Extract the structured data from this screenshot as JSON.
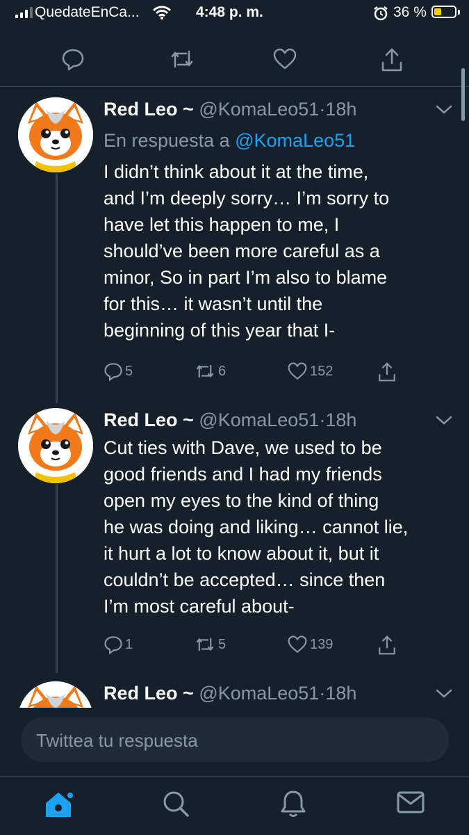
{
  "status_bar": {
    "carrier": "QuedateEnCa...",
    "time": "4:48 p. m.",
    "battery_percent": "36 %",
    "battery_level": 0.36,
    "icons": [
      "signal-icon",
      "wifi-icon",
      "alarm-icon",
      "battery-icon"
    ]
  },
  "previous_tweet_actions": {
    "icons": [
      "reply-icon",
      "retweet-icon",
      "like-icon",
      "share-icon"
    ]
  },
  "tweets": [
    {
      "name": "Red Leo ~",
      "handle": "@KomaLeo51",
      "time": "·18h",
      "reply_prefix": "En respuesta a ",
      "reply_to": "@KomaLeo51",
      "body_lines": [
        "I didn’t think about it at the time,",
        "and I’m deeply sorry… I’m sorry to",
        "have let this happen to me, I",
        "should’ve been more careful as a",
        "minor, So in part I’m also to blame",
        "for this… it wasn’t until the",
        "beginning of this year that I-"
      ],
      "replies": "5",
      "retweets": "6",
      "likes": "152"
    },
    {
      "name": "Red Leo ~",
      "handle": "@KomaLeo51",
      "time": "·18h",
      "body_lines": [
        "Cut ties with Dave, we used to be",
        "good friends and I had my friends",
        "open my eyes to the kind of thing",
        "he was doing and liking… cannot lie,",
        "it hurt a lot to know about it, but it",
        "couldn’t be accepted… since then",
        "I’m most careful about-"
      ],
      "replies": "1",
      "retweets": "5",
      "likes": "139"
    },
    {
      "name": "Red Leo ~",
      "handle": "@KomaLeo51",
      "time": "·18h"
    }
  ],
  "composer": {
    "placeholder": "Twittea tu respuesta"
  },
  "tab_bar": {
    "tabs": [
      "home-icon",
      "search-icon",
      "notifications-icon",
      "messages-icon"
    ],
    "active_color": "#1da1f2"
  },
  "colors": {
    "background": "#15202b",
    "secondary_text": "#8899a6",
    "accent": "#1da1f2"
  }
}
